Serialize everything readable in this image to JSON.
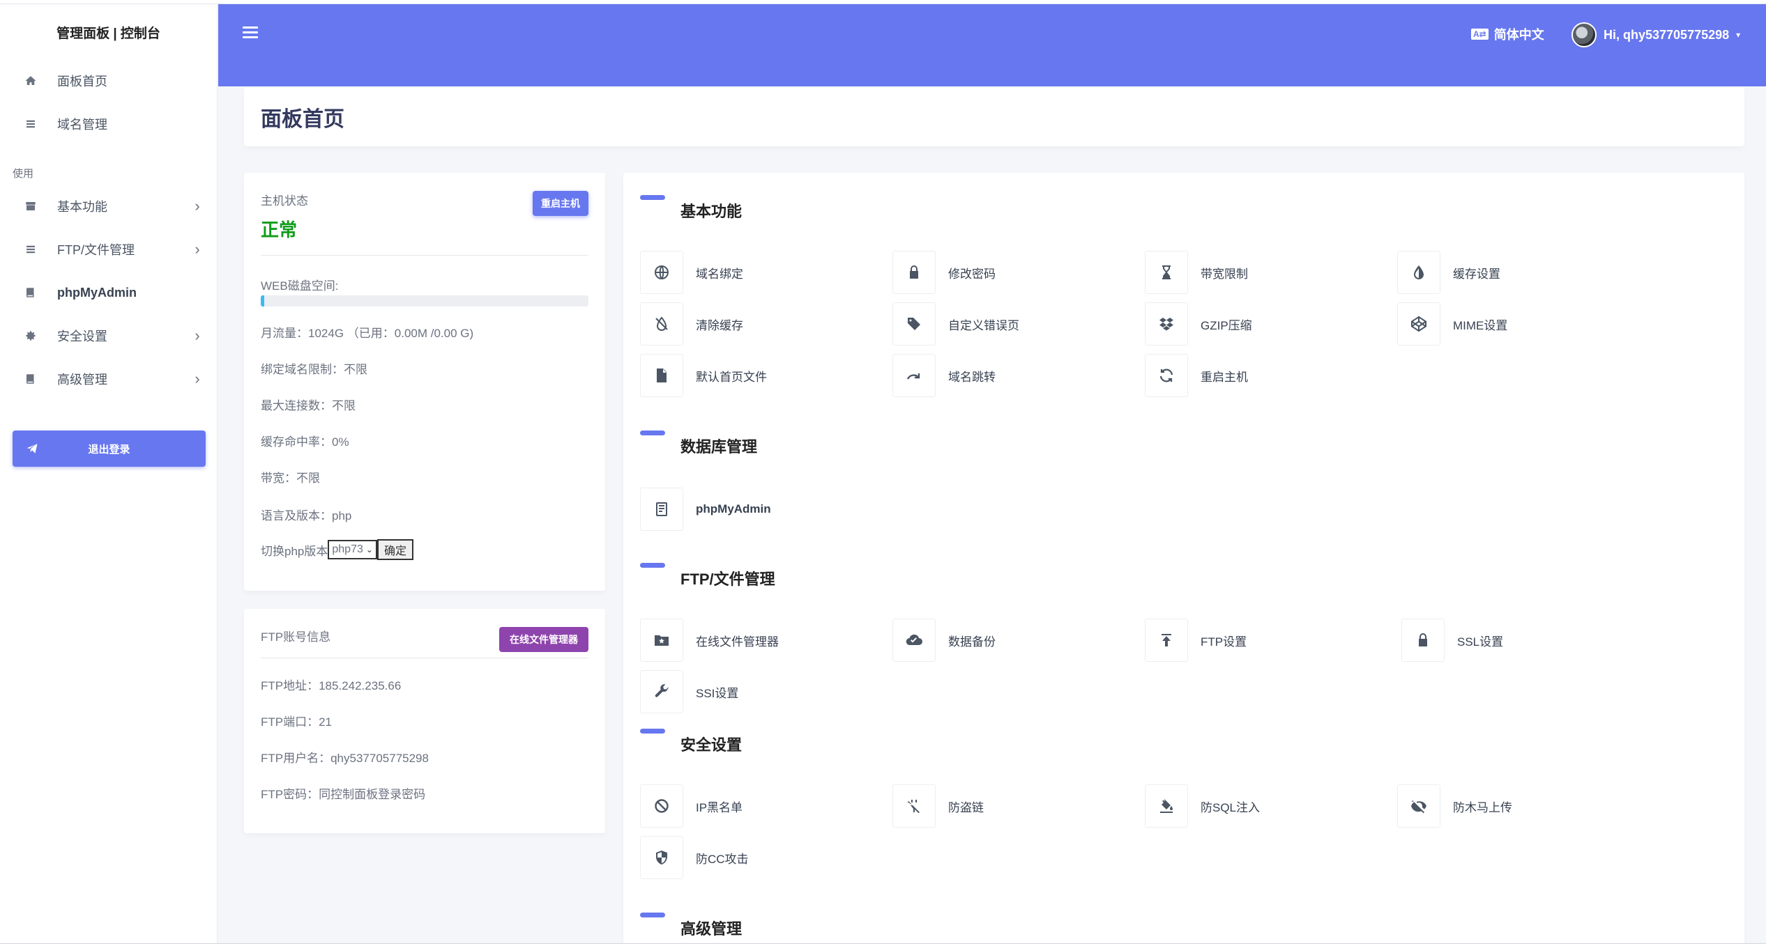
{
  "brand": "管理面板 | 控制台",
  "sidebar": {
    "items": [
      {
        "label": "面板首页"
      },
      {
        "label": "域名管理"
      },
      {
        "label": "基本功能"
      },
      {
        "label": "FTP/文件管理"
      },
      {
        "label": "phpMyAdmin"
      },
      {
        "label": "安全设置"
      },
      {
        "label": "高级管理"
      }
    ],
    "section_label": "使用",
    "logout_label": "退出登录"
  },
  "header": {
    "language": "简体中文",
    "user_greeting": "Hi, qhy537705775298"
  },
  "page_title": "面板首页",
  "host": {
    "label": "主机状态",
    "restart_btn": "重启主机",
    "status": "正常",
    "disk_label": "WEB磁盘空间:",
    "disk_used_percent": 1,
    "traffic": "月流量：1024G （已用：0.00M /0.00 G)",
    "domain_limit": "绑定域名限制：不限",
    "max_conn": "最大连接数：不限",
    "cache_hit": "缓存命中率：0%",
    "bandwidth": "带宽：不限",
    "language": "语言及版本：php",
    "php_switch_label": "切换php版本",
    "php_version": "php73",
    "php_ok": "确定"
  },
  "ftp": {
    "label": "FTP账号信息",
    "fm_btn": "在线文件管理器",
    "address": "FTP地址：185.242.235.66",
    "port": "FTP端口：21",
    "user": "FTP用户名：qhy537705775298",
    "password": "FTP密码：同控制面板登录密码"
  },
  "sections": {
    "basic": {
      "title": "基本功能",
      "items": [
        "域名绑定",
        "修改密码",
        "带宽限制",
        "缓存设置",
        "清除缓存",
        "自定义错误页",
        "GZIP压缩",
        "MIME设置",
        "默认首页文件",
        "域名跳转",
        "重启主机"
      ]
    },
    "db": {
      "title": "数据库管理",
      "items": [
        "phpMyAdmin"
      ]
    },
    "ftp": {
      "title": "FTP/文件管理",
      "items": [
        "在线文件管理器",
        "数据备份",
        "FTP设置",
        "SSL设置",
        "SSI设置"
      ]
    },
    "security": {
      "title": "安全设置",
      "items": [
        "IP黑名单",
        "防盗链",
        "防SQL注入",
        "防木马上传",
        "防CC攻击"
      ]
    },
    "advanced": {
      "title": "高级管理"
    }
  },
  "colors": {
    "primary": "#6777ef",
    "fm_button": "#8e44ad",
    "status_ok": "#0f9d19",
    "progress": "#3abaf4"
  }
}
